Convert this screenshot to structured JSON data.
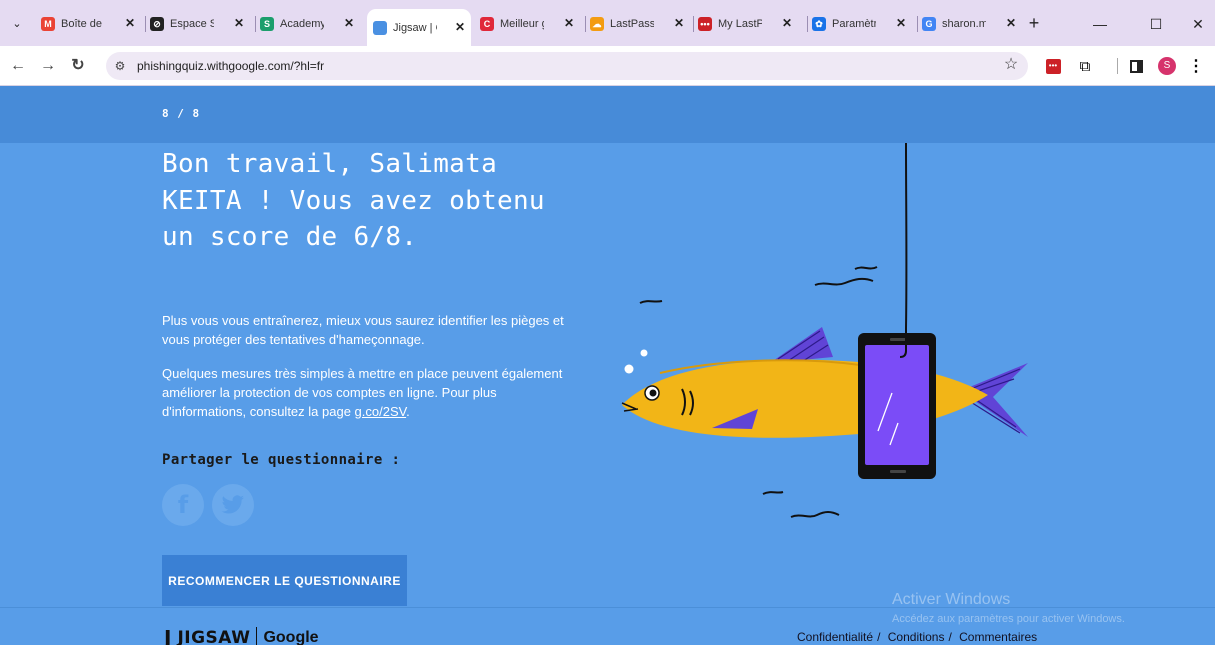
{
  "browser": {
    "tabs": [
      {
        "title": "Boîte de r",
        "favicon": "gmail-icon",
        "color": "#ea4335",
        "glyph": "M"
      },
      {
        "title": "Espace S/",
        "favicon": "disabled-icon",
        "color": "#222222",
        "glyph": "⊘"
      },
      {
        "title": "Academy",
        "favicon": "academy-icon",
        "color": "#1b9e6c",
        "glyph": "S"
      },
      {
        "title": "Jigsaw | C",
        "favicon": "jigsaw-icon",
        "color": "#4a90e2",
        "glyph": "",
        "active": true
      },
      {
        "title": "Meilleur g",
        "favicon": "canva-icon",
        "color": "#e0283a",
        "glyph": "C"
      },
      {
        "title": "LastPass:",
        "favicon": "rainbow-icon",
        "color": "#f39c12",
        "glyph": "☁"
      },
      {
        "title": "My LastPa",
        "favicon": "lastpass-icon",
        "color": "#cc2127",
        "glyph": "•••"
      },
      {
        "title": "Paramètre",
        "favicon": "gear-icon",
        "color": "#1a73e8",
        "glyph": "✿"
      },
      {
        "title": "sharon.m",
        "favicon": "google-icon",
        "color": "#4285f4",
        "glyph": "G"
      }
    ],
    "url": "phishingquiz.withgoogle.com/?hl=fr",
    "profile_initial": "S"
  },
  "page": {
    "progress": "8 / 8",
    "headline": "Bon travail, Salimata KEITA ! Vous avez obtenu un score de 6/8.",
    "para1": "Plus vous vous entraînerez, mieux vous saurez identifier les pièges et vous protéger des tentatives d'hameçonnage.",
    "para2_prefix": "Quelques mesures très simples à mettre en place peuvent également améliorer la protection de vos comptes en ligne. Pour plus d'informations, consultez la page ",
    "para2_link": "g.co/2SV",
    "para2_suffix": ".",
    "share_label": "Partager le questionnaire :",
    "restart_label": "RECOMMENCER LE QUESTIONNAIRE"
  },
  "footer": {
    "brand": "JIGSAW",
    "brand_google": "Google",
    "links": [
      "Confidentialité",
      "Conditions",
      "Commentaires"
    ],
    "separator": "/"
  },
  "watermark": {
    "title": "Activer Windows",
    "subtitle": "Accédez aux paramètres pour activer Windows."
  },
  "colors": {
    "page_bg": "#589de8",
    "header_bg": "#478bd8",
    "button_bg": "#3a80d4",
    "fish": "#f2b517",
    "fin": "#6044d6",
    "phone_screen": "#7b4cf7"
  }
}
